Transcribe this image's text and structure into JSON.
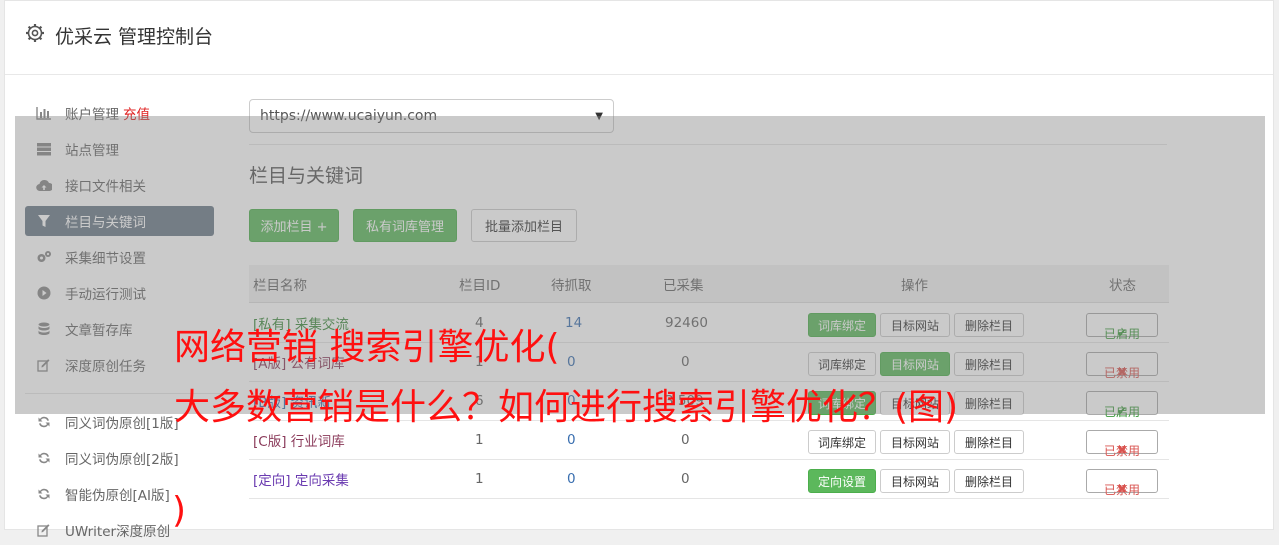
{
  "header": {
    "title": "优采云 管理控制台",
    "icon": "gear-icon"
  },
  "sidebar": {
    "items": [
      {
        "label": "账户管理",
        "extra": "充值",
        "icon": "bar-chart-icon"
      },
      {
        "label": "站点管理",
        "icon": "server-icon"
      },
      {
        "label": "接口文件相关",
        "icon": "cloud-upload-icon"
      },
      {
        "label": "栏目与关键词",
        "icon": "filter-icon"
      },
      {
        "label": "采集细节设置",
        "icon": "cogs-icon"
      },
      {
        "label": "手动运行测试",
        "icon": "play-icon"
      },
      {
        "label": "文章暂存库",
        "icon": "database-icon"
      },
      {
        "label": "深度原创任务",
        "icon": "edit-icon"
      },
      {
        "label": "同义词伪原创[1版]",
        "icon": "refresh-icon"
      },
      {
        "label": "同义词伪原创[2版]",
        "icon": "refresh-icon"
      },
      {
        "label": "智能伪原创[AI版]",
        "icon": "refresh-icon"
      },
      {
        "label": "UWriter深度原创",
        "icon": "edit-icon"
      }
    ]
  },
  "main": {
    "site_select": "https://www.ucaiyun.com",
    "section_title": "栏目与关键词",
    "buttons": {
      "add": "添加栏目 +",
      "private_lib": "私有词库管理",
      "batch_add": "批量添加栏目"
    },
    "table": {
      "headers": [
        "栏目名称",
        "栏目ID",
        "待抓取",
        "已采集",
        "操作",
        "状态"
      ],
      "rows": [
        {
          "name": "[私有] 采集交流",
          "id": "4",
          "pending": "14",
          "collected": "92460",
          "op1": "词库绑定",
          "op2": "目标网站",
          "op3": "删除栏目",
          "status": "已启用"
        },
        {
          "name": "[A版] 公有词库",
          "id": "1",
          "pending": "0",
          "collected": "0",
          "op1": "词库绑定",
          "op2": "目标网站",
          "op3": "删除栏目",
          "status": "已禁用"
        },
        {
          "name": "[B版] 资讯新",
          "id": "6",
          "pending": "0",
          "collected": "3 509",
          "op1": "词库绑定",
          "op2": "目标网站",
          "op3": "删除栏目",
          "status": "已启用"
        },
        {
          "name": "[C版] 行业词库",
          "id": "1",
          "pending": "0",
          "collected": "0",
          "op1": "词库绑定",
          "op2": "目标网站",
          "op3": "删除栏目",
          "status": "已禁用"
        },
        {
          "name": "[定向] 定向采集",
          "id": "1",
          "pending": "0",
          "collected": "0",
          "op1": "定向设置",
          "op2": "目标网站",
          "op3": "删除栏目",
          "status": "已禁用"
        }
      ]
    }
  },
  "banner": {
    "line1": "网络营销 搜索引擎优化(",
    "line2": "大多数营销是什么？如何进行搜索引擎优化？(图)",
    "line3": ")"
  },
  "colors": {
    "accent_green": "#5cb85c",
    "active_nav": "#6c7a89",
    "banner_red": "#ff1010"
  }
}
